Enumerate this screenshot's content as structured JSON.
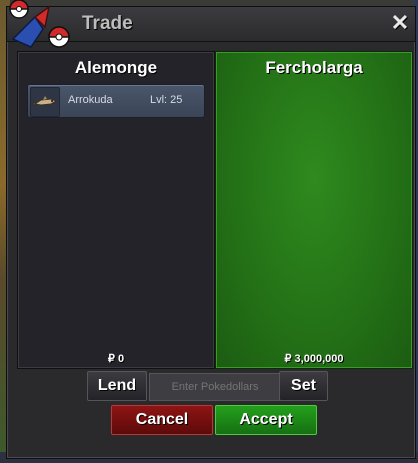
{
  "window": {
    "title": "Trade",
    "close_label": "✕"
  },
  "left_panel": {
    "player_name": "Alemonge",
    "items": [
      {
        "name": "Arrokuda",
        "level": "Lvl: 25",
        "icon": "arrokuda-icon"
      }
    ],
    "money": "₽ 0"
  },
  "right_panel": {
    "player_name": "Fercholarga",
    "money": "₽ 3,000,000"
  },
  "controls": {
    "lend_label": "Lend",
    "pokedollars_placeholder": "Enter Pokedollars",
    "set_label": "Set",
    "cancel_label": "Cancel",
    "accept_label": "Accept"
  },
  "colors": {
    "accept": "#23a01c",
    "cancel": "#8e1414",
    "other_offer_panel": "#237016"
  }
}
